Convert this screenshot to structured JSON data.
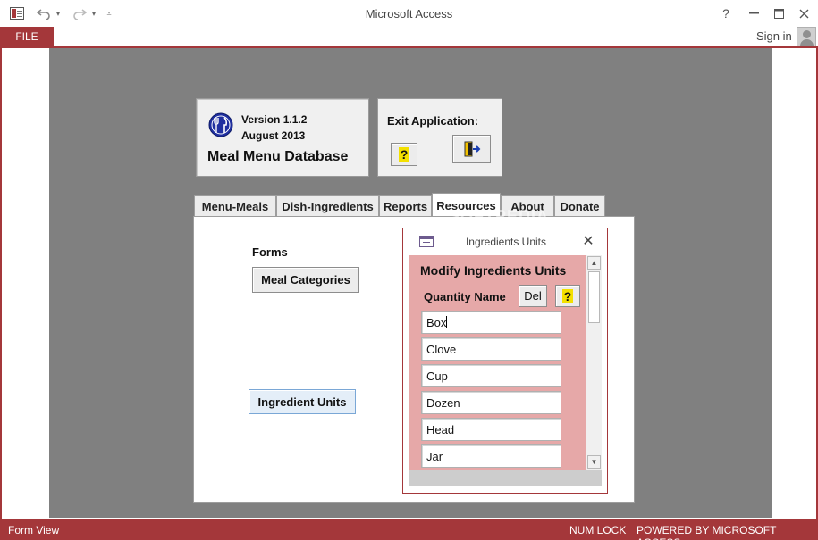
{
  "window": {
    "title": "Microsoft Access",
    "help": "?",
    "sign_in": "Sign in"
  },
  "ribbon": {
    "file_tab": "FILE"
  },
  "header": {
    "version": "Version 1.1.2",
    "date": "August 2013",
    "app_title": "Meal Menu Database"
  },
  "exit_panel": {
    "label": "Exit Application:",
    "help_button": "?"
  },
  "tabs": [
    {
      "label": "Menu-Meals"
    },
    {
      "label": "Dish-Ingredients"
    },
    {
      "label": "Reports"
    },
    {
      "label": "Resources"
    },
    {
      "label": "About"
    },
    {
      "label": "Donate"
    }
  ],
  "active_tab": "Resources",
  "resources": {
    "forms_label": "Forms",
    "meal_categories_button": "Meal Categories",
    "ingredient_units_button": "Ingredient Units"
  },
  "popup": {
    "title": "Ingredients Units",
    "heading": "Modify Ingredients Units",
    "column_label": "Quantity Name",
    "del_button": "Del",
    "help_button": "?",
    "units": [
      "Box",
      "Clove",
      "Cup",
      "Dozen",
      "Head",
      "Jar"
    ]
  },
  "watermark": "SOFTPEDIA",
  "status": {
    "view": "Form View",
    "num_lock": "NUM LOCK",
    "powered_by": "POWERED BY MICROSOFT ACCESS"
  },
  "colors": {
    "accent": "#a4373a",
    "workspace": "#808080",
    "subform_bg": "#e6a8a8",
    "help_icon": "#f3e000"
  }
}
